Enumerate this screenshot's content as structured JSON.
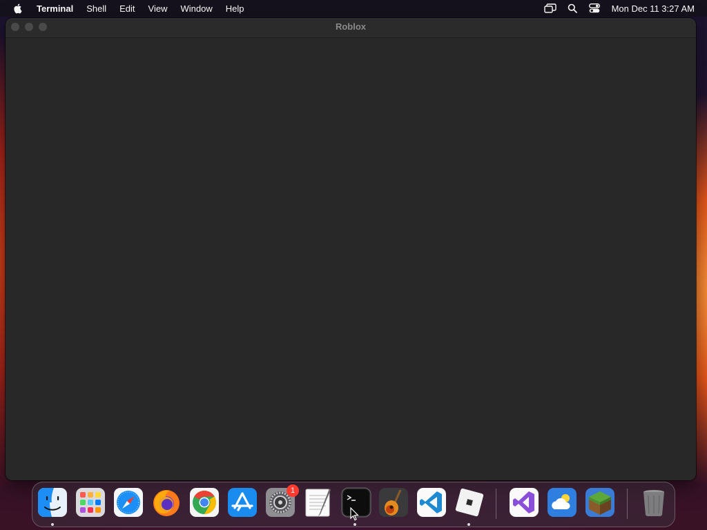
{
  "menubar": {
    "app_name": "Terminal",
    "items": [
      "Shell",
      "Edit",
      "View",
      "Window",
      "Help"
    ],
    "status_icons": [
      "screen-mirroring-icon",
      "search-icon",
      "control-center-icon"
    ],
    "clock": "Mon Dec 11  3:27 AM"
  },
  "window": {
    "title": "Roblox"
  },
  "dock": {
    "apps": [
      "Finder",
      "Launchpad",
      "Safari",
      "Firefox",
      "Google Chrome",
      "App Store",
      "System Settings",
      "TextEdit",
      "Terminal",
      "GarageBand",
      "Visual Studio Code",
      "Roblox",
      "Visual Studio",
      "Weather",
      "Minecraft",
      "Trash"
    ],
    "settings_badge": "1",
    "running": [
      "Finder",
      "Terminal",
      "Roblox"
    ]
  },
  "colors": {
    "window_bg": "#282828",
    "titlebar_bg": "#2b2b2b",
    "badge": "#ff3b30"
  }
}
